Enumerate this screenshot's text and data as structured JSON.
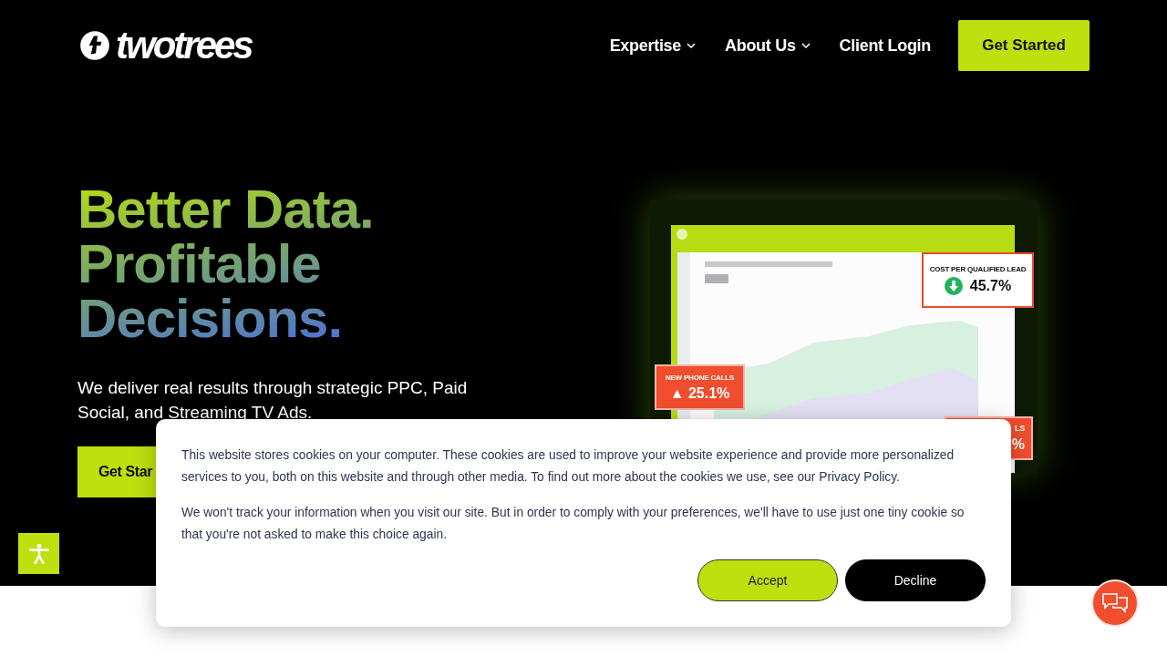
{
  "header": {
    "logo": "twotrees",
    "nav": [
      {
        "label": "Expertise",
        "dropdown": true
      },
      {
        "label": "About Us",
        "dropdown": true
      },
      {
        "label": "Client Login",
        "dropdown": false
      }
    ],
    "cta": "Get Started"
  },
  "hero": {
    "heading_lines": [
      "Better Data.",
      "Profitable",
      "Decisions."
    ],
    "text": "We deliver real results through strategic PPC, Paid Social, and Streaming TV Ads.",
    "button": "Get Star",
    "dashboard": {
      "badges": [
        {
          "label": "COST PER QUALIFIED LEAD",
          "value": "45.7%",
          "kind": "cost"
        },
        {
          "label": "NEW PHONE CALLS",
          "value": "▲ 25.1%",
          "kind": "calls"
        },
        {
          "label": "LS",
          "value": "%",
          "kind": "calls"
        }
      ]
    }
  },
  "cookie_banner": {
    "paragraphs": [
      "This website stores cookies on your computer. These cookies are used to improve your website experience and provide more personalized services to you, both on this website and through other media. To find out more about the cookies we use, see our Privacy Policy.",
      "We won't track your information when you visit our site. But in order to comply with your preferences, we'll have to use just one tiny cookie so that you're not asked to make this choice again."
    ],
    "buttons": [
      {
        "label": "Accept",
        "kind": "accept"
      },
      {
        "label": "Decline",
        "kind": "decline"
      }
    ]
  }
}
